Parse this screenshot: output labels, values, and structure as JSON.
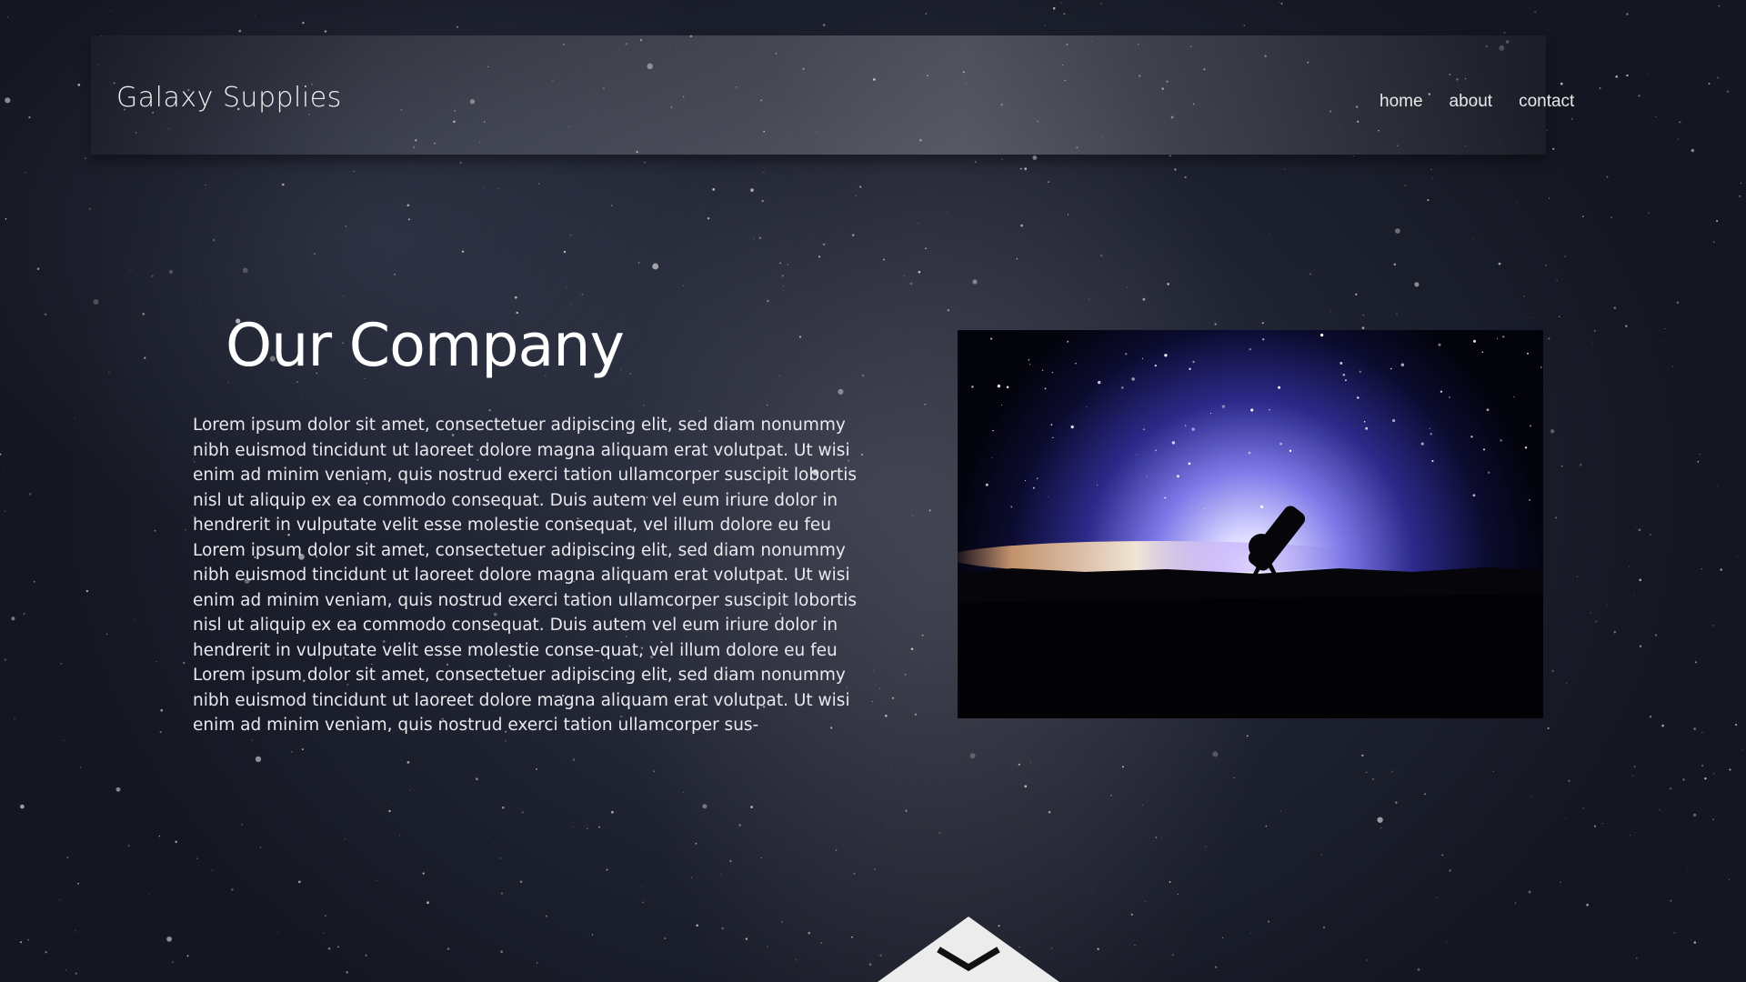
{
  "site": {
    "brand": "Galaxy Supplies"
  },
  "nav": {
    "items": [
      "home",
      "about",
      "contact"
    ]
  },
  "main": {
    "title": "Our Company",
    "body": "Lorem ipsum dolor sit amet, consectetuer adipiscing elit, sed diam nonummy nibh euismod tincidunt ut laoreet dolore magna aliquam erat volutpat. Ut wisi enim ad minim veniam, quis nostrud exerci tation ullamcorper suscipit lobortis nisl ut aliquip ex ea commodo consequat. Duis autem vel eum iriure dolor in hendrerit in vulputate velit esse molestie consequat, vel illum dolore eu feu Lorem ipsum dolor sit amet, consectetuer adipiscing elit, sed diam nonummy nibh euismod tincidunt ut laoreet dolore magna aliquam erat volutpat. Ut wisi enim ad minim veniam, quis nostrud exerci tation ullamcorper suscipit lobortis nisl ut aliquip ex ea commodo consequat. Duis autem vel eum iriure dolor in hendrerit in vulputate velit esse molestie conse-quat, vel illum dolore eu feu Lorem ipsum dolor sit amet, consectetuer adipiscing elit, sed diam nonummy nibh euismod tincidunt ut laoreet dolore magna aliquam erat volutpat. Ut wisi enim ad minim veniam, quis nostrud exerci tation ullamcorper sus-"
  },
  "icons": {
    "scroll": "chevron-down-icon",
    "photo": "telescope-night-sky-image"
  },
  "colors": {
    "background": "#1e2230",
    "text": "#ffffff",
    "scroll_button": "#ececec"
  }
}
